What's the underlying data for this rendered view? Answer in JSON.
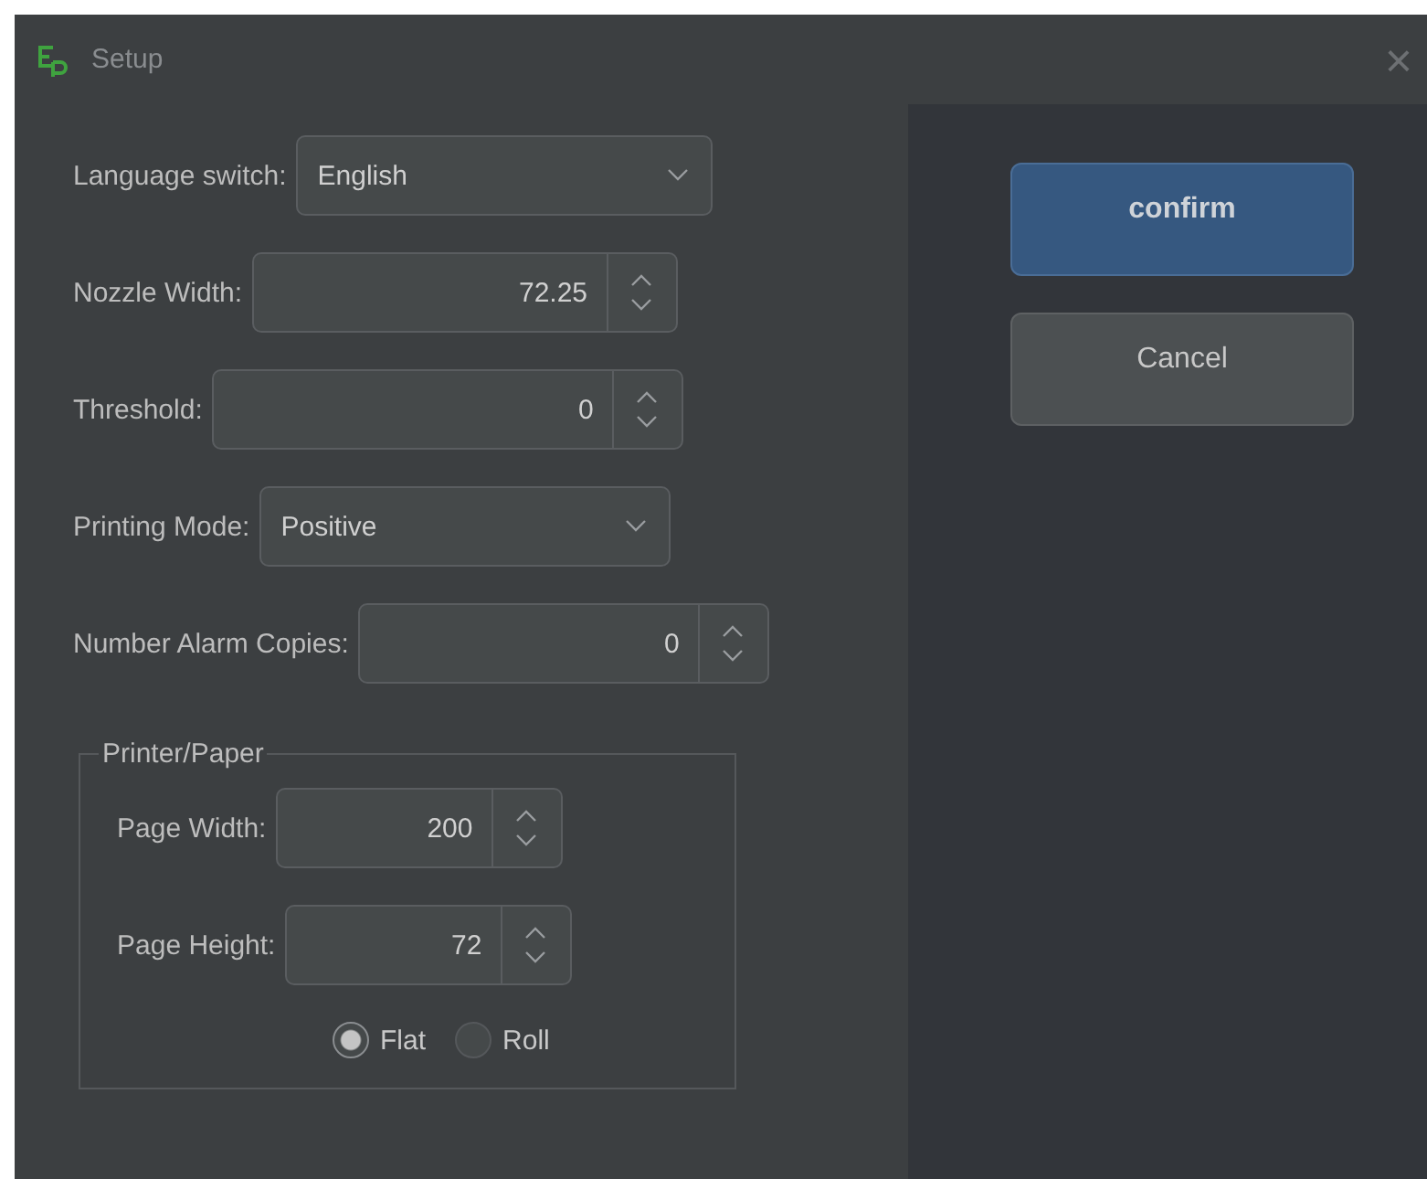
{
  "window": {
    "title": "Setup",
    "close": "×"
  },
  "settings": [
    {
      "kind": "combo",
      "label": "Language switch:",
      "value": "English"
    },
    {
      "kind": "spin",
      "label": "Nozzle Width:",
      "value": "72.25"
    },
    {
      "kind": "spin",
      "label": "Threshold:",
      "value": "0"
    },
    {
      "kind": "combo",
      "label": "Printing Mode:",
      "value": "Positive"
    },
    {
      "kind": "spin",
      "label": "Number Alarm Copies:",
      "value": "0"
    }
  ],
  "printer_paper": {
    "title": "Printer/Paper",
    "fields": [
      {
        "label": "Page Width:",
        "value": "200"
      },
      {
        "label": "Page Height:",
        "value": "72"
      }
    ],
    "paper_type": [
      {
        "label": "Flat",
        "selected": true
      },
      {
        "label": "Roll",
        "selected": false
      }
    ]
  },
  "buttons": [
    {
      "label": "confirm",
      "kind": "primary"
    },
    {
      "label": "Cancel",
      "kind": "secondary"
    }
  ]
}
